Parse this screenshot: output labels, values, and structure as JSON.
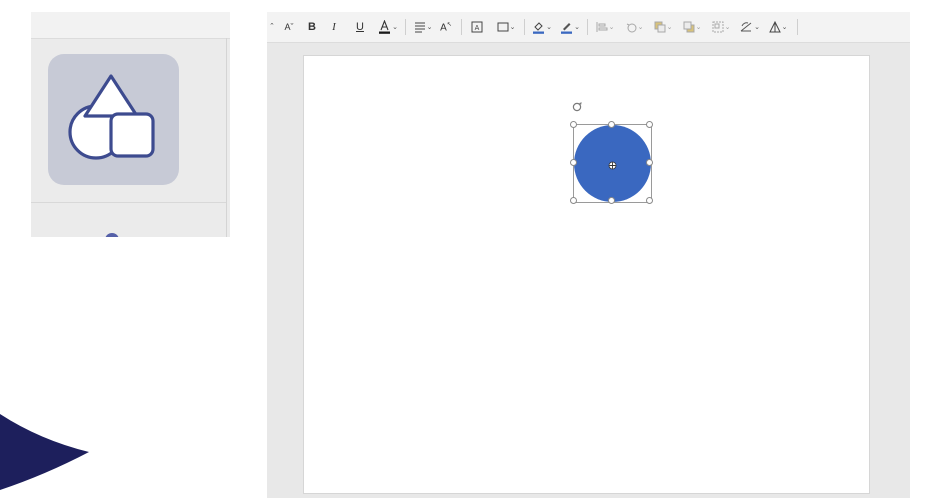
{
  "inset": {
    "icon": "shapes-icon",
    "tile_color": "#c7cad6",
    "stroke_color": "#3d4b8f"
  },
  "toolbar": {
    "items": [
      {
        "name": "decrease-font-icon",
        "glyph": "Aˇ"
      },
      {
        "name": "bold-button",
        "glyph": "B"
      },
      {
        "name": "italic-button",
        "glyph": "I"
      },
      {
        "name": "underline-button",
        "glyph": "U"
      },
      {
        "name": "font-color-icon",
        "glyph": "A"
      },
      {
        "name": "align-icon",
        "glyph": "≡"
      },
      {
        "name": "text-direction-icon",
        "glyph": "A"
      }
    ],
    "font_color_bar": "#1a1a1a",
    "fill_color_bar": "#3a68c0",
    "line_color_bar": "#3a68c0"
  },
  "slide": {
    "shape": {
      "type": "circle",
      "fill": "#3a68c0",
      "selected": true
    }
  }
}
